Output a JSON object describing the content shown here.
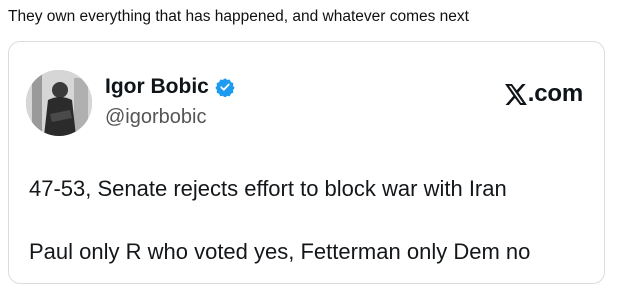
{
  "caption": "They own everything that has happened, and whatever comes next",
  "embed": {
    "author": {
      "display_name": "Igor Bobic",
      "handle": "@igorbobic",
      "avatar_icon": "profile-photo"
    },
    "source": {
      "logo_icon": "x-logo-icon",
      "domain": ".com"
    },
    "text_lines": [
      "47-53, Senate rejects effort to block war with Iran",
      "Paul only R who voted yes, Fetterman only Dem no"
    ]
  },
  "colors": {
    "verified_badge": "#1d9bf0",
    "card_border": "#dcdcdc",
    "handle": "#555555"
  }
}
